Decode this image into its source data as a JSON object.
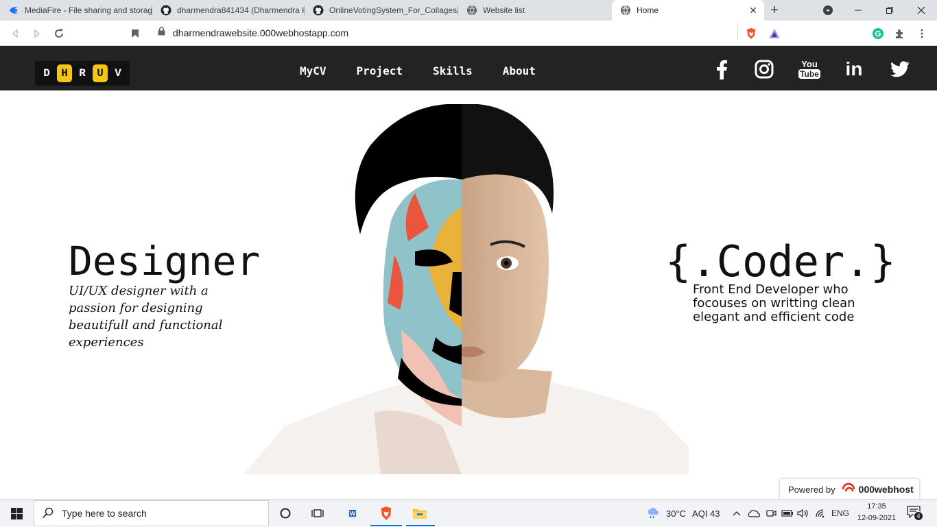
{
  "browser": {
    "tabs": [
      {
        "title": "MediaFire - File sharing and storag",
        "icon": "mediafire-icon",
        "active": false
      },
      {
        "title": "dharmendra841434 (Dharmendra K",
        "icon": "github-icon",
        "active": false
      },
      {
        "title": "OnlineVotingSystem_For_Collages/",
        "icon": "github-icon",
        "active": false
      },
      {
        "title": "Website list",
        "icon": "globe-icon",
        "active": false
      },
      {
        "title": "Home",
        "icon": "globe-icon",
        "active": true
      }
    ],
    "url": "dharmendrawebsite.000webhostapp.com"
  },
  "site": {
    "logo_letters": [
      "D",
      "H",
      "R",
      "U",
      "V"
    ],
    "nav": [
      "MyCV",
      "Project",
      "Skills",
      "About"
    ],
    "social": [
      "facebook-icon",
      "instagram-icon",
      "youtube-icon",
      "linkedin-icon",
      "twitter-icon"
    ],
    "youtube_you": "You",
    "youtube_tube": "Tube",
    "linkedin_text": "in"
  },
  "hero": {
    "designer_title": "Designer",
    "designer_desc": "UI/UX designer with a passion for designing beautifull and functional experiences",
    "coder_title": "{.Coder.}",
    "coder_desc": "Front End Developer who focouses on writting clean elegant and efficient code"
  },
  "powered": {
    "label": "Powered by",
    "brand": "000webhost"
  },
  "taskbar": {
    "search_placeholder": "Type here to search",
    "weather": "30°C",
    "aqi": "AQI 43",
    "lang": "ENG",
    "time": "17:35",
    "date": "12-09-2021",
    "notifications": "4"
  },
  "colors": {
    "header_bg": "#232323",
    "logo_accent": "#f5c518",
    "tabstrip_bg": "#dee1e6",
    "taskbar_bg": "#f1f3f6"
  }
}
